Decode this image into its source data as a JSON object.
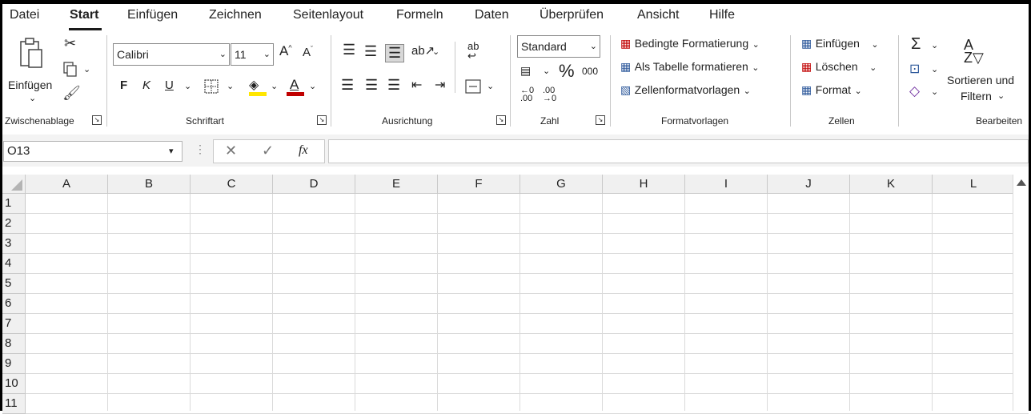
{
  "tabs": [
    "Datei",
    "Start",
    "Einfügen",
    "Zeichnen",
    "Seitenlayout",
    "Formeln",
    "Daten",
    "Überprüfen",
    "Ansicht",
    "Hilfe"
  ],
  "clipboard": {
    "paste_label": "Einfügen",
    "group_label": "Zwischenablage"
  },
  "font": {
    "name": "Calibri",
    "size": "11",
    "bold": "F",
    "italic": "K",
    "underline": "U",
    "group_label": "Schriftart"
  },
  "alignment": {
    "group_label": "Ausrichtung"
  },
  "number": {
    "format": "Standard",
    "percent": "%",
    "thousands": "000",
    "group_label": "Zahl"
  },
  "styles": {
    "conditional": "Bedingte Formatierung",
    "as_table": "Als Tabelle formatieren",
    "cell_styles": "Zellenformatvorlagen",
    "group_label": "Formatvorlagen"
  },
  "cells": {
    "insert": "Einfügen",
    "delete": "Löschen",
    "format": "Format",
    "group_label": "Zellen"
  },
  "editing": {
    "sort_filter_line1": "Sortieren und",
    "sort_filter_line2": "Filtern",
    "group_label": "Bearbeiten"
  },
  "formula_bar": {
    "name_box": "O13",
    "fx": "fx",
    "value": ""
  },
  "sheet": {
    "columns": [
      "A",
      "B",
      "C",
      "D",
      "E",
      "F",
      "G",
      "H",
      "I",
      "J",
      "K",
      "L"
    ],
    "rows": [
      "1",
      "2",
      "3",
      "4",
      "5",
      "6",
      "7",
      "8",
      "9",
      "10",
      "11"
    ]
  },
  "icons": [
    "cut-icon",
    "copy-icon",
    "format-painter-icon",
    "font-grow-icon",
    "font-shrink-icon",
    "borders-icon",
    "fill-color-icon",
    "font-color-icon",
    "align-top-icon",
    "align-middle-icon",
    "align-bottom-icon",
    "orientation-icon",
    "wrap-text-icon",
    "align-left-icon",
    "align-center-icon",
    "align-right-icon",
    "indent-decrease-icon",
    "indent-increase-icon",
    "merge-icon",
    "accounting-icon",
    "decimal-increase-icon",
    "decimal-decrease-icon",
    "autosum-icon",
    "fill-icon",
    "clear-icon",
    "sort-filter-icon",
    "cancel-icon",
    "enter-icon",
    "function-icon"
  ],
  "colors": {
    "fill_color": "#ffe600",
    "font_color": "#c00000",
    "accent": "#217346"
  }
}
